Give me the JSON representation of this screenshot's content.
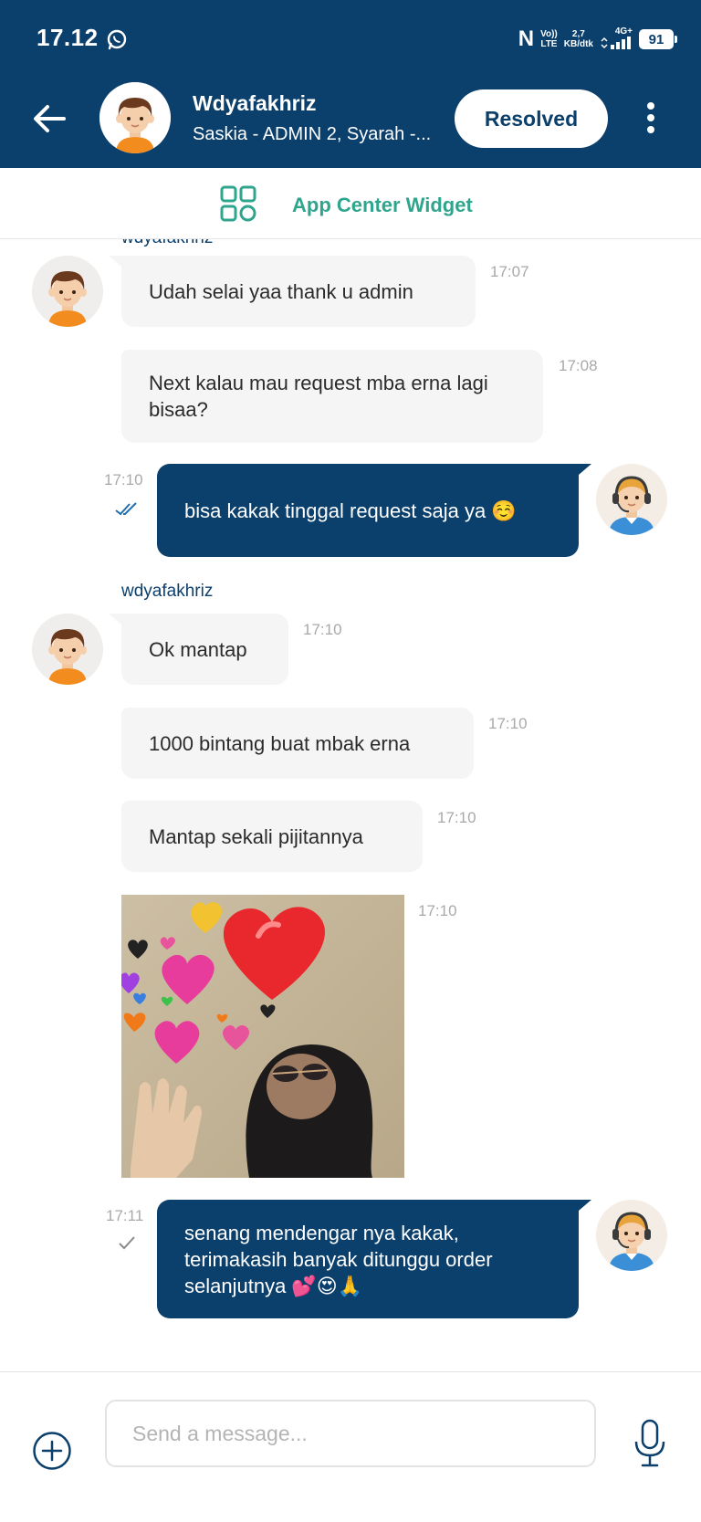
{
  "status_bar": {
    "time": "17.12",
    "nfc": "N",
    "volte_top": "Vo))",
    "volte_bottom": "LTE",
    "speed_top": "2,7",
    "speed_bottom": "KB/dtk",
    "network": "4G+",
    "battery": "91"
  },
  "header": {
    "title": "Wdyafakhriz",
    "subtitle": "Saskia - ADMIN 2, Syarah -...",
    "resolved_label": "Resolved",
    "background": "#0b3f6c"
  },
  "widget": {
    "label": "App Center Widget",
    "accent": "#2fa58e"
  },
  "messages": [
    {
      "sender": "wdyafakhriz",
      "text": "Udah selai yaa thank u admin",
      "time": "17:07"
    },
    {
      "text": "Next kalau mau request mba erna lagi bisaa?",
      "time": "17:08"
    },
    {
      "text": "bisa kakak tinggal request saja ya ☺️",
      "time": "17:10",
      "status": "read"
    },
    {
      "sender": "wdyafakhriz",
      "text": "Ok mantap",
      "time": "17:10"
    },
    {
      "text": "1000 bintang buat mbak erna",
      "time": "17:10"
    },
    {
      "text": "Mantap sekali pijitannya",
      "time": "17:10"
    },
    {
      "image": "hearts-meme-image",
      "time": "17:10"
    },
    {
      "text": "senang mendengar nya kakak, terimakasih banyak ditunggu order selanjutnya 💕😍🙏",
      "time": "17:11",
      "status": "sent"
    }
  ],
  "composer": {
    "placeholder": "Send a message..."
  }
}
